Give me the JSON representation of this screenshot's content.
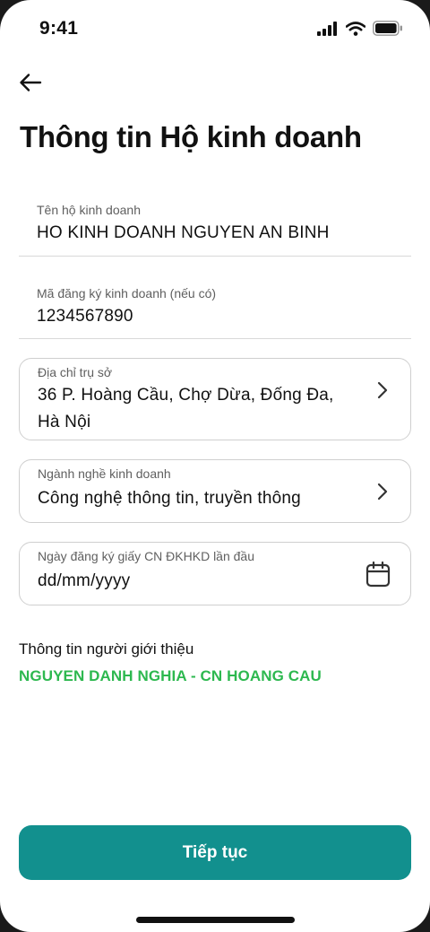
{
  "status": {
    "time": "9:41"
  },
  "header": {
    "title": "Thông tin Hộ kinh doanh"
  },
  "fields": {
    "business_name": {
      "label": "Tên hộ kinh doanh",
      "value": "HO KINH DOANH NGUYEN AN BINH"
    },
    "registration_code": {
      "label": "Mã đăng ký kinh doanh (nếu có)",
      "value": "1234567890"
    },
    "address": {
      "label": "Địa chỉ trụ sở",
      "value_line1": "36 P. Hoàng Cầu, Chợ Dừa, Đống Đa,",
      "value_line2": "Hà Nội"
    },
    "industry": {
      "label": "Ngành nghề kinh doanh",
      "value": "Công nghệ thông tin, truyền thông"
    },
    "registration_date": {
      "label": "Ngày đăng ký giấy CN ĐKHKD lần đầu",
      "placeholder": "dd/mm/yyyy"
    }
  },
  "referrer": {
    "label": "Thông tin người giới thiệu",
    "value": "NGUYEN DANH NGHIA - CN HOANG CAU"
  },
  "actions": {
    "continue_label": "Tiếp tục"
  },
  "icons": {
    "back": "arrow-left-icon",
    "chevron": "chevron-right-icon",
    "calendar": "calendar-icon",
    "signal": "signal-icon",
    "wifi": "wifi-icon",
    "battery": "battery-icon"
  },
  "colors": {
    "accent": "#12908e",
    "referrer": "#2db84f"
  }
}
